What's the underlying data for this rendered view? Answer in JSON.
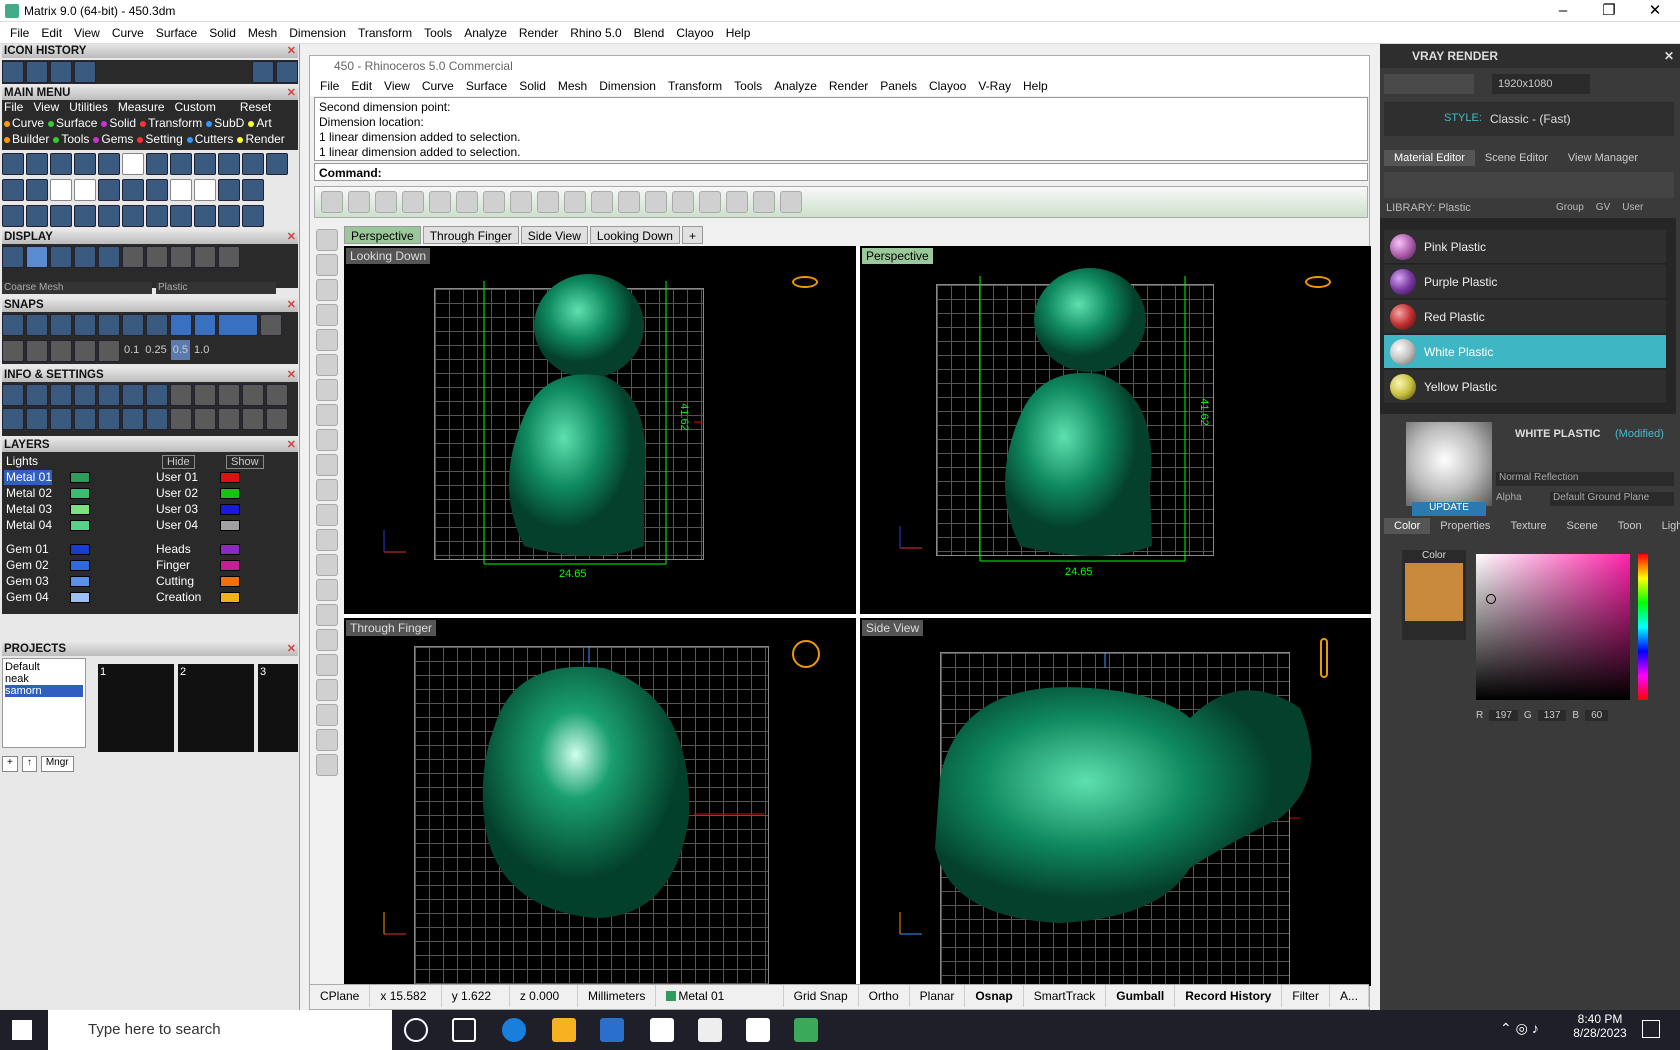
{
  "window": {
    "title": "Matrix 9.0 (64-bit) - 450.3dm",
    "minimize": "–",
    "maximize": "❐",
    "close": "✕"
  },
  "menu": [
    "File",
    "Edit",
    "View",
    "Curve",
    "Surface",
    "Solid",
    "Mesh",
    "Dimension",
    "Transform",
    "Tools",
    "Analyze",
    "Render",
    "Rhino 5.0",
    "Blend",
    "Clayoo",
    "Help"
  ],
  "left": {
    "icon_history": "ICON HISTORY",
    "main_menu": "MAIN MENU",
    "main_menu_row1": [
      "File",
      "View",
      "Utilities",
      "Measure",
      "Custom",
      "Reset"
    ],
    "main_menu_row2": [
      "Curve",
      "Surface",
      "Solid",
      "Transform",
      "SubD",
      "Art"
    ],
    "main_menu_row3": [
      "Builder",
      "Tools",
      "Gems",
      "Setting",
      "Cutters",
      "Render"
    ],
    "display": "DISPLAY",
    "display_mode1": "Coarse Mesh",
    "display_mode2": "Plastic",
    "snaps": "SNAPS",
    "snap_values": [
      "0.1",
      "0.25",
      "0.5",
      "1.0"
    ],
    "info": "INFO & SETTINGS",
    "layers_header": "LAYERS",
    "lights": "Lights",
    "hide": "Hide",
    "show": "Show",
    "layers_left": [
      {
        "name": "Metal 01",
        "color": "#2e9b5c"
      },
      {
        "name": "Metal 02",
        "color": "#3dbb6e"
      },
      {
        "name": "Metal 03",
        "color": "#7fe07f"
      },
      {
        "name": "Metal 04",
        "color": "#5acf8a"
      },
      {
        "name": "Gem 01",
        "color": "#1a3ccc"
      },
      {
        "name": "Gem 02",
        "color": "#2f6ad8"
      },
      {
        "name": "Gem 03",
        "color": "#5c90e6"
      },
      {
        "name": "Gem 04",
        "color": "#9cc0f0"
      }
    ],
    "layers_right": [
      {
        "name": "User 01",
        "color": "#e01010"
      },
      {
        "name": "User 02",
        "color": "#18c018"
      },
      {
        "name": "User 03",
        "color": "#1818e0"
      },
      {
        "name": "User 04",
        "color": "#a0a0a0"
      },
      {
        "name": "Heads",
        "color": "#8a2ac0"
      },
      {
        "name": "Finger",
        "color": "#c02090"
      },
      {
        "name": "Cutting",
        "color": "#f07010"
      },
      {
        "name": "Creation",
        "color": "#f0b020"
      }
    ],
    "projects_header": "PROJECTS",
    "projects": [
      "Default",
      "neak",
      "samorn"
    ],
    "project_thumbs": [
      "1",
      "2",
      "3"
    ],
    "mngr": "Mngr"
  },
  "rhino": {
    "title": "450 - Rhinoceros 5.0 Commercial",
    "menu": [
      "File",
      "Edit",
      "View",
      "Curve",
      "Surface",
      "Solid",
      "Mesh",
      "Dimension",
      "Transform",
      "Tools",
      "Analyze",
      "Render",
      "Panels",
      "Clayoo",
      "V-Ray",
      "Help"
    ],
    "history": [
      "Second dimension point:",
      "Dimension location:",
      "1 linear dimension added to selection.",
      "1 linear dimension added to selection."
    ],
    "command": "Command:",
    "tabs": [
      "Perspective",
      "Through Finger",
      "Side View",
      "Looking Down"
    ],
    "viewports": [
      {
        "label": "Looking Down",
        "dim_h": "24.65",
        "dim_v": "41.62"
      },
      {
        "label": "Perspective",
        "dim_h": "24.65",
        "dim_v": "41.62"
      },
      {
        "label": "Through Finger"
      },
      {
        "label": "Side View"
      }
    ],
    "status": {
      "cplane": "CPlane",
      "x": "x 15.582",
      "y": "y 1.622",
      "z": "z 0.000",
      "units": "Millimeters",
      "layer": "Metal 01",
      "layer_color": "#2e9b5c",
      "grid": "Grid Snap",
      "ortho": "Ortho",
      "planar": "Planar",
      "osnap": "Osnap",
      "smarttrack": "SmartTrack",
      "gumball": "Gumball",
      "record": "Record History",
      "filter": "Filter",
      "more": "A..."
    }
  },
  "vray": {
    "title": "VRAY RENDER",
    "resolution": "1920x1080",
    "style_label": "STYLE:",
    "style": "Classic - (Fast)",
    "tabs": [
      "Material Editor",
      "Scene Editor",
      "View Manager"
    ],
    "library": "LIBRARY: Plastic",
    "group": "Group",
    "gv": "GV",
    "user": "User",
    "materials": [
      {
        "name": "Pink Plastic",
        "color": "#b060b0"
      },
      {
        "name": "Purple Plastic",
        "color": "#7a3aa0"
      },
      {
        "name": "Red Plastic",
        "color": "#c03030"
      },
      {
        "name": "White Plastic",
        "color": "#e0e0e0",
        "selected": true
      },
      {
        "name": "Yellow Plastic",
        "color": "#c8c040"
      }
    ],
    "selected_name": "WHITE PLASTIC",
    "modified": "(Modified)",
    "reflection": "Normal Reflection",
    "alpha": "Alpha",
    "ground": "Default Ground Plane",
    "update": "UPDATE",
    "subtabs": [
      "Color",
      "Properties",
      "Texture",
      "Scene",
      "Toon",
      "Lights"
    ],
    "color_label": "Color",
    "swatch": "#c98a3c",
    "r": "197",
    "g": "137",
    "b": "60",
    "r_label": "R",
    "g_label": "G",
    "b_label": "B"
  },
  "taskbar": {
    "search": "Type here to search",
    "time": "8:40 PM",
    "date": "8/28/2023"
  }
}
